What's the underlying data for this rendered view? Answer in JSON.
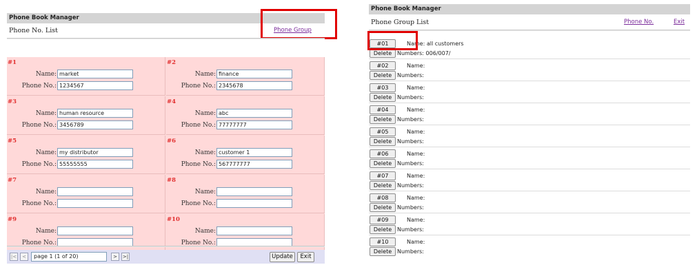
{
  "left": {
    "app_title": "Phone Book Manager",
    "page_title": "Phone No. List",
    "phone_group_link": "Phone Group",
    "name_label": "Name:",
    "phone_label": "Phone No.:",
    "entries": [
      {
        "num": "#1",
        "name": "market",
        "phone": "1234567"
      },
      {
        "num": "#2",
        "name": "finance",
        "phone": "2345678"
      },
      {
        "num": "#3",
        "name": "human resource",
        "phone": "3456789"
      },
      {
        "num": "#4",
        "name": "abc",
        "phone": "77777777"
      },
      {
        "num": "#5",
        "name": "my distributor",
        "phone": "55555555"
      },
      {
        "num": "#6",
        "name": "customer 1",
        "phone": "567777777"
      },
      {
        "num": "#7",
        "name": "",
        "phone": ""
      },
      {
        "num": "#8",
        "name": "",
        "phone": ""
      },
      {
        "num": "#9",
        "name": "",
        "phone": ""
      },
      {
        "num": "#10",
        "name": "",
        "phone": ""
      }
    ],
    "pager": {
      "first_icon": "first-page-icon",
      "prev_icon": "prev-page-icon",
      "next_icon": "next-page-icon",
      "last_icon": "last-page-icon",
      "page_select": "page 1 (1 of 20)",
      "update_label": "Update",
      "exit_label": "Exit"
    }
  },
  "right": {
    "app_title": "Phone Book Manager",
    "page_title": "Phone Group List",
    "phone_no_link": "Phone No.",
    "exit_link": "Exit",
    "name_label": "Name:",
    "numbers_label": "Numbers:",
    "delete_label": "Delete",
    "groups": [
      {
        "no": "#01",
        "name": "all customers",
        "numbers": "006/007/"
      },
      {
        "no": "#02",
        "name": "",
        "numbers": ""
      },
      {
        "no": "#03",
        "name": "",
        "numbers": ""
      },
      {
        "no": "#04",
        "name": "",
        "numbers": ""
      },
      {
        "no": "#05",
        "name": "",
        "numbers": ""
      },
      {
        "no": "#06",
        "name": "",
        "numbers": ""
      },
      {
        "no": "#07",
        "name": "",
        "numbers": ""
      },
      {
        "no": "#08",
        "name": "",
        "numbers": ""
      },
      {
        "no": "#09",
        "name": "",
        "numbers": ""
      },
      {
        "no": "#10",
        "name": "",
        "numbers": ""
      }
    ]
  },
  "colors": {
    "highlight": "#e00000",
    "cell_bg": "#ffd9d9",
    "number_red": "#e23030",
    "link_purple": "#7a2a9a",
    "header_gray": "#d4d4d4",
    "pager_bg": "#e0e0f4"
  }
}
